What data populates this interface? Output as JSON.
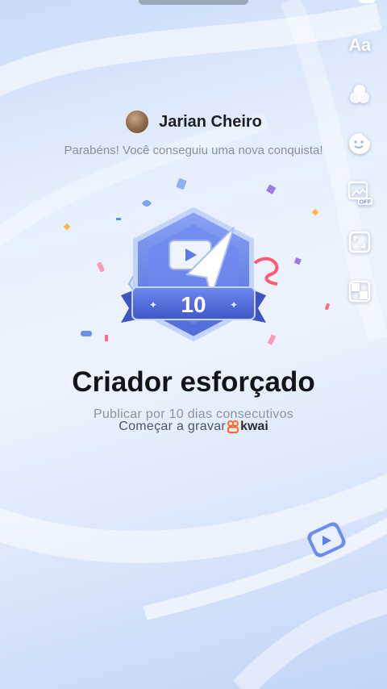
{
  "toolbar": {
    "text_tool_label": "Aa",
    "tools": [
      {
        "name": "text-tool",
        "icon": "text-aa-icon"
      },
      {
        "name": "filter-tool",
        "icon": "color-circles-icon"
      },
      {
        "name": "sticker-tool",
        "icon": "sticker-face-icon"
      },
      {
        "name": "cover-tool",
        "icon": "image-off-icon",
        "badge": "OFF"
      },
      {
        "name": "expand-tool",
        "icon": "expand-icon"
      },
      {
        "name": "mosaic-tool",
        "icon": "mosaic-icon"
      }
    ]
  },
  "user": {
    "name": "Jarian Cheiro"
  },
  "achievement": {
    "congrats": "Parabéns! Você conseguiu uma nova conquista!",
    "badge_number": "10",
    "title": "Criador esforçado",
    "subtitle": "Publicar por 10 dias consecutivos",
    "cta": "Começar a gravar",
    "brand": "kwai"
  },
  "colors": {
    "badge_primary": "#5b7bea",
    "badge_dark": "#3f56c8",
    "accent_orange": "#ff6a2b",
    "background": "#e6effd"
  }
}
